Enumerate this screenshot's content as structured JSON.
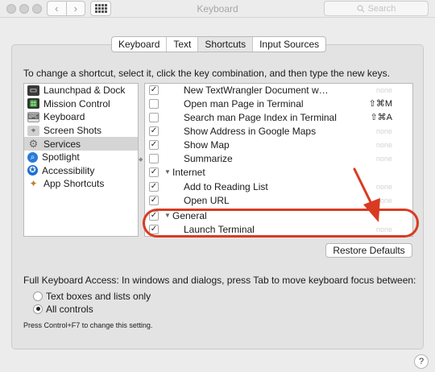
{
  "window": {
    "title": "Keyboard",
    "search_placeholder": "Search"
  },
  "toolbar": {
    "back_icon": "‹",
    "forward_icon": "›"
  },
  "tabs": [
    {
      "label": "Keyboard",
      "active": false
    },
    {
      "label": "Text",
      "active": false
    },
    {
      "label": "Shortcuts",
      "active": true
    },
    {
      "label": "Input Sources",
      "active": false
    }
  ],
  "instruction": "To change a shortcut, select it, click the key combination, and then type the new keys.",
  "categories": [
    {
      "label": "Launchpad & Dock",
      "icon": "launchpad-icon"
    },
    {
      "label": "Mission Control",
      "icon": "mission-control-icon"
    },
    {
      "label": "Keyboard",
      "icon": "keyboard-icon"
    },
    {
      "label": "Screen Shots",
      "icon": "screenshot-icon"
    },
    {
      "label": "Services",
      "icon": "services-gear-icon",
      "selected": true
    },
    {
      "label": "Spotlight",
      "icon": "spotlight-icon"
    },
    {
      "label": "Accessibility",
      "icon": "accessibility-icon"
    },
    {
      "label": "App Shortcuts",
      "icon": "app-shortcuts-icon"
    }
  ],
  "shortcuts": [
    {
      "label": "New TextWrangler Document w…",
      "checked": true,
      "key": "none"
    },
    {
      "label": "Open man Page in Terminal",
      "checked": false,
      "key": "⇧⌘M"
    },
    {
      "label": "Search man Page Index in Terminal",
      "checked": false,
      "key": "⇧⌘A"
    },
    {
      "label": "Show Address in Google Maps",
      "checked": true,
      "key": "none"
    },
    {
      "label": "Show Map",
      "checked": true,
      "key": "none"
    },
    {
      "label": "Summarize",
      "checked": false,
      "key": "none"
    },
    {
      "label": "Internet",
      "checked": true,
      "group": true
    },
    {
      "label": "Add to Reading List",
      "checked": true,
      "key": "none"
    },
    {
      "label": "Open URL",
      "checked": true,
      "key": "none"
    },
    {
      "label": "General",
      "checked": true,
      "group": true
    },
    {
      "label": "Launch Terminal",
      "checked": true,
      "key": "none"
    }
  ],
  "restore_label": "Restore Defaults",
  "full_keyboard_access": {
    "text": "Full Keyboard Access: In windows and dialogs, press Tab to move keyboard focus between:",
    "options": [
      {
        "label": "Text boxes and lists only",
        "selected": false
      },
      {
        "label": "All controls",
        "selected": true
      }
    ],
    "hint": "Press Control+F7 to change this setting."
  },
  "help_label": "?",
  "colors": {
    "annotation": "#d93b22",
    "selected_row": "#d5d5d5"
  }
}
